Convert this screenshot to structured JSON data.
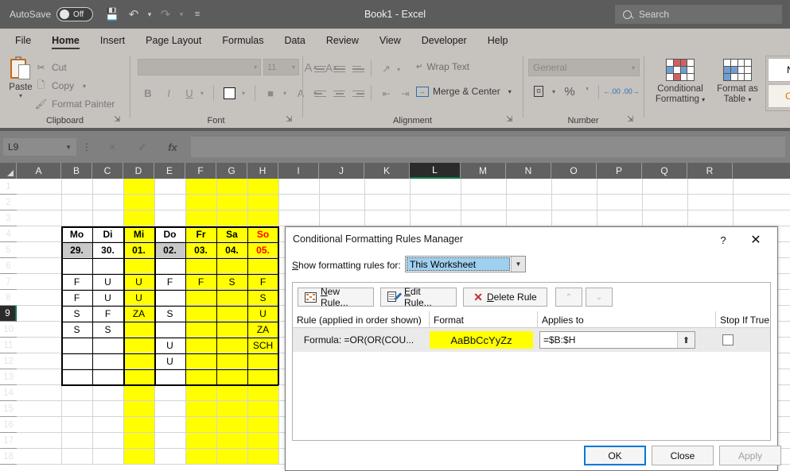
{
  "titlebar": {
    "autosave_label": "AutoSave",
    "autosave_state": "Off",
    "doc_title": "Book1  -  Excel",
    "quick_access": [
      "save-icon",
      "undo-icon",
      "redo-icon",
      "customize-icon"
    ]
  },
  "search": {
    "placeholder": "Search"
  },
  "tabs": [
    {
      "label": "File",
      "active": false
    },
    {
      "label": "Home",
      "active": true
    },
    {
      "label": "Insert",
      "active": false
    },
    {
      "label": "Page Layout",
      "active": false
    },
    {
      "label": "Formulas",
      "active": false
    },
    {
      "label": "Data",
      "active": false
    },
    {
      "label": "Review",
      "active": false
    },
    {
      "label": "View",
      "active": false
    },
    {
      "label": "Developer",
      "active": false
    },
    {
      "label": "Help",
      "active": false
    }
  ],
  "ribbon": {
    "groups": [
      {
        "label": "Clipboard"
      },
      {
        "label": "Font"
      },
      {
        "label": "Alignment"
      },
      {
        "label": "Number"
      }
    ],
    "clipboard": {
      "paste_label": "Paste",
      "cut_label": "Cut",
      "copy_label": "Copy",
      "format_painter_label": "Format Painter"
    },
    "font": {
      "font_name": "",
      "font_size": "11",
      "bold": "B",
      "italic": "I",
      "underline": "U",
      "grow_font": "A",
      "shrink_font": "A"
    },
    "alignment": {
      "wrap_text_label": "Wrap Text",
      "merge_center_label": "Merge & Center"
    },
    "number": {
      "format_value": "General",
      "percent": "%",
      "comma": "'",
      "increase_decimal": ".00",
      "decrease_decimal": ".00"
    },
    "styles": {
      "conditional_formatting_label": "Conditional\nFormatting",
      "conditional_formatting_line1": "Conditional",
      "conditional_formatting_line2": "Formatting",
      "format_as_table_line1": "Format as",
      "format_as_table_line2": "Table",
      "gallery": [
        "Norma",
        "Calcula"
      ]
    }
  },
  "formula_bar": {
    "name_box": "L9",
    "cancel_icon": "×",
    "enter_icon": "✓",
    "fx_icon": "fx",
    "content": ""
  },
  "sheet": {
    "columns": [
      "A",
      "B",
      "C",
      "D",
      "E",
      "F",
      "G",
      "H",
      "I",
      "J",
      "K",
      "L",
      "M",
      "N",
      "O",
      "P",
      "Q",
      "R"
    ],
    "selected_column": "L",
    "rows": [
      "1",
      "2",
      "3",
      "4",
      "5",
      "6",
      "7",
      "8",
      "9",
      "10",
      "11",
      "12",
      "13",
      "14",
      "15",
      "16",
      "17",
      "18"
    ],
    "selected_row": "9",
    "selected_cell": "L9",
    "yellow_columns": [
      "D",
      "F",
      "G",
      "H"
    ],
    "table": {
      "header_row": [
        "Mo",
        "Di",
        "Mi",
        "Do",
        "Fr",
        "Sa",
        "So"
      ],
      "date_row": [
        "29.",
        "30.",
        "01.",
        "02.",
        "03.",
        "04.",
        "05."
      ],
      "data_rows": [
        [
          "",
          "",
          "",
          "",
          "",
          "",
          ""
        ],
        [
          "F",
          "U",
          "U",
          "F",
          "F",
          "S",
          "F"
        ],
        [
          "F",
          "U",
          "U",
          "",
          "",
          "",
          "S"
        ],
        [
          "S",
          "F",
          "ZA",
          "S",
          "",
          "",
          "U"
        ],
        [
          "S",
          "S",
          "",
          "",
          "",
          "",
          "ZA"
        ],
        [
          "",
          "",
          "",
          "U",
          "",
          "",
          "SCH"
        ],
        [
          "",
          "",
          "",
          "U",
          "",
          "",
          ""
        ],
        [
          "",
          "",
          "",
          "",
          "",
          "",
          ""
        ]
      ]
    }
  },
  "dialog": {
    "title": "Conditional Formatting Rules Manager",
    "help_icon": "?",
    "close_icon": "✕",
    "show_rules_label_pre": "S",
    "show_rules_label_post": "how formatting rules for:",
    "show_rules_value": "This Worksheet",
    "buttons": {
      "new_rule_pre": "N",
      "new_rule_post": "ew Rule...",
      "edit_rule_pre": "E",
      "edit_rule_post": "dit Rule...",
      "delete_rule_pre": "D",
      "delete_rule_post": "elete Rule",
      "move_up": "⌃",
      "move_down": "⌄"
    },
    "list_headers": [
      "Rule (applied in order shown)",
      "Format",
      "Applies to",
      "Stop If True"
    ],
    "rules": [
      {
        "rule": "Formula: =OR(OR(COU...",
        "format_preview": "AaBbCcYyZz",
        "format_bg": "#ffff00",
        "applies_to": "=$B:$H",
        "stop_if_true": false
      }
    ],
    "footer": {
      "ok": "OK",
      "close": "Close",
      "apply": "Apply"
    }
  },
  "colors": {
    "accent": "#0078d7",
    "highlight_yellow": "#ffff00",
    "selection_green": "#0e7c4a",
    "ribbon_bg": "#c6c2bd",
    "titlebar_bg": "#5c5c5c"
  }
}
